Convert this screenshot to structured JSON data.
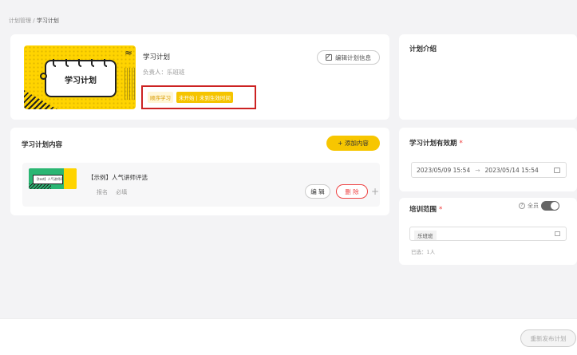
{
  "breadcrumb": {
    "parent": "计划管理",
    "separator": "/",
    "current": "学习计划"
  },
  "plan": {
    "cover_title": "学习计划",
    "title": "学习计划",
    "owner": "负责人：乐班班",
    "edit_label": "编辑计划信息",
    "tags": [
      "顺序学习",
      "未开始 | 未到生效时间"
    ]
  },
  "intro": {
    "title": "计划介绍"
  },
  "content": {
    "title": "学习计划内容",
    "add_label": "+ 添加内容",
    "items": [
      {
        "thumb_text": "【test】人气讲师评选",
        "title": "【示例】人气讲师评选",
        "meta": "报名 必填",
        "edit_label": "编 辑",
        "delete_label": "删 除",
        "plus": "+"
      }
    ]
  },
  "validity": {
    "title": "学习计划有效期",
    "required_mark": "*",
    "start": "2023/05/09 15:54",
    "arrow": "→",
    "end": "2023/05/14 15:54"
  },
  "scope": {
    "title": "培训范围",
    "required_mark": "*",
    "all_staff_label": "全员",
    "toggle_on": true,
    "chip": "乐班班",
    "selected_count": "已选：1人"
  },
  "footer": {
    "republish_label": "重新发布计划"
  },
  "colors": {
    "accent": "#f7c600",
    "danger": "#e44444",
    "highlight_box": "#cc2222"
  }
}
